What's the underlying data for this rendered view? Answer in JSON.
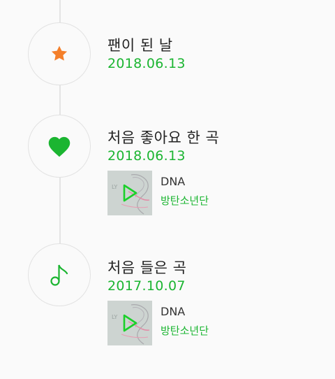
{
  "colors": {
    "accent_green": "#1bb531",
    "star_orange": "#f47f2a",
    "title_text": "#222222"
  },
  "timeline": [
    {
      "icon": "star-icon",
      "title": "팬이 된 날",
      "date": "2018.06.13"
    },
    {
      "icon": "heart-icon",
      "title": "처음 좋아요 한 곡",
      "date": "2018.06.13",
      "song": {
        "title": "DNA",
        "artist": "방탄소년단",
        "thumb_icon": "play-icon"
      }
    },
    {
      "icon": "music-note-icon",
      "title": "처음 들은 곡",
      "date": "2017.10.07",
      "song": {
        "title": "DNA",
        "artist": "방탄소년단",
        "thumb_icon": "play-icon"
      }
    }
  ]
}
